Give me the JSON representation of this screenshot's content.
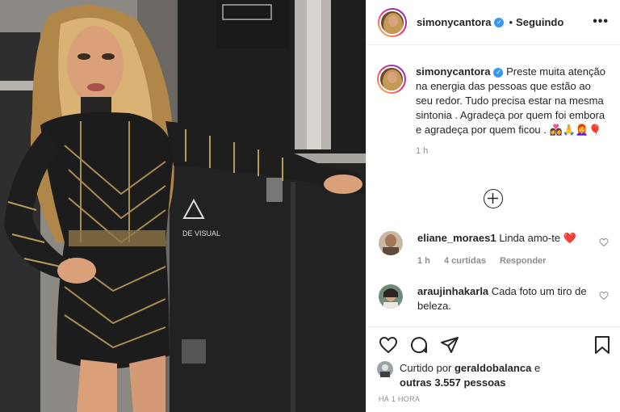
{
  "header": {
    "username": "simonycantora",
    "separator": "•",
    "following": "Seguindo",
    "more": "•••"
  },
  "caption": {
    "username": "simonycantora",
    "text": "Preste muita atenção na energia das pessoas que estão ao seu redor. Tudo precisa estar na mesma sintonia . Agradeça por quem foi embora e agradeça por quem ficou .",
    "emoji": "👩‍❤️‍👩🙏👩‍🦰🎈",
    "time": "1 h"
  },
  "comments": [
    {
      "username": "eliane_moraes1",
      "text": "Linda amo-te",
      "emoji": "❤️",
      "time": "1 h",
      "likes": "4 curtidas",
      "reply": "Responder"
    },
    {
      "username": "araujinhakarla",
      "text": "Cada foto um tiro de beleza."
    }
  ],
  "likes": {
    "prefix": "Curtido por",
    "user": "geraldobalanca",
    "connector": "e",
    "others": "outras 3.557 pessoas"
  },
  "posted_ago": "HÁ 1 HORA",
  "photo": {
    "case_logo_text": "DE VISUAL"
  },
  "colors": {
    "verified": "#3897f0",
    "heart": "#ed4956",
    "muted": "#8e8e8e"
  }
}
